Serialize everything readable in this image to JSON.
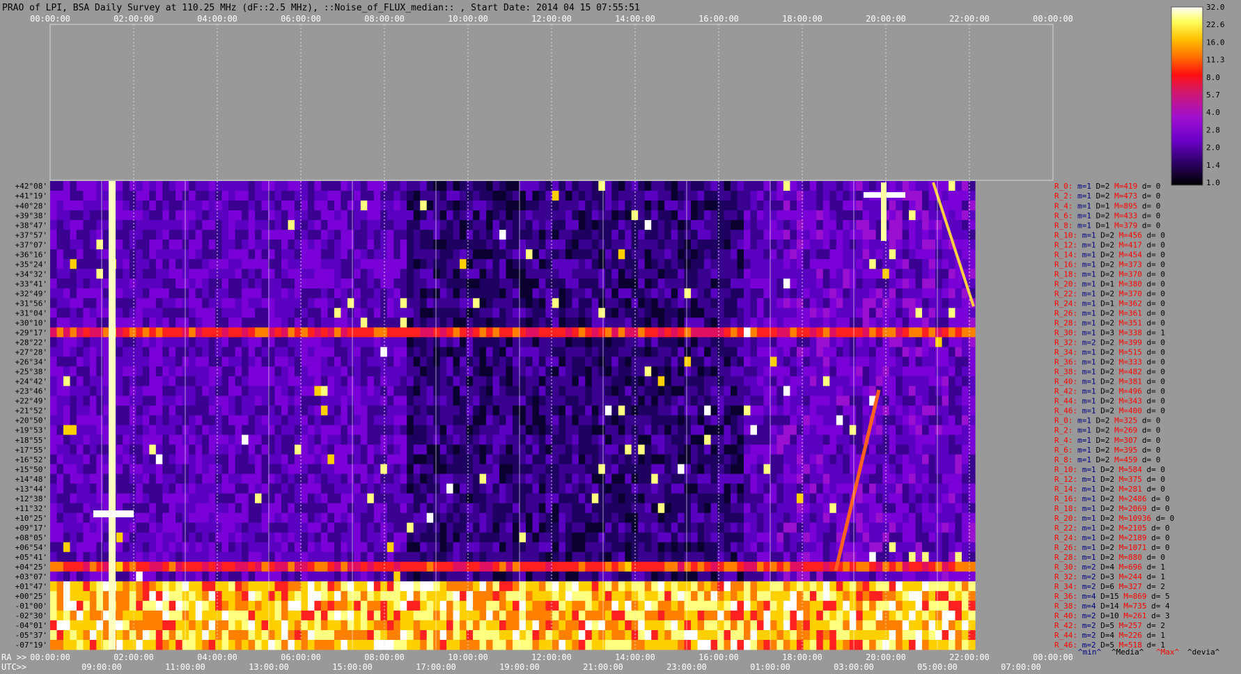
{
  "chart_data": {
    "type": "heatmap",
    "title": "PRAO of LPI, BSA Daily Survey at 110.25 MHz (dF::2.5 MHz), ::Noise_of_FLUX_median:: , Start Date: 2014 04 15 07:55:51",
    "top_axis": {
      "ticks": [
        "00:00:00",
        "02:00:00",
        "04:00:00",
        "06:00:00",
        "08:00:00",
        "10:00:00",
        "12:00:00",
        "14:00:00",
        "16:00:00",
        "18:00:00",
        "20:00:00",
        "22:00:00",
        "00:00:00"
      ]
    },
    "ra_axis": {
      "label": "RA >>",
      "ticks": [
        "00:00:00",
        "02:00:00",
        "04:00:00",
        "06:00:00",
        "08:00:00",
        "10:00:00",
        "12:00:00",
        "14:00:00",
        "16:00:00",
        "18:00:00",
        "20:00:00",
        "22:00:00",
        "00:00:00"
      ]
    },
    "utc_axis": {
      "label": "UTC>>",
      "ticks": [
        "09:00:00",
        "11:00:00",
        "13:00:00",
        "15:00:00",
        "17:00:00",
        "19:00:00",
        "21:00:00",
        "23:00:00",
        "01:00:00",
        "03:00:00",
        "05:00:00",
        "07:00:00"
      ]
    },
    "declinations": [
      "+42°08'",
      "+41°19'",
      "+40°28'",
      "+39°38'",
      "+38°47'",
      "+37°57'",
      "+37°07'",
      "+36°16'",
      "+35°24'",
      "+34°32'",
      "+33°41'",
      "+32°49'",
      "+31°56'",
      "+31°04'",
      "+30°10'",
      "+29°17'",
      "+28°22'",
      "+27°28'",
      "+26°34'",
      "+25°38'",
      "+24°42'",
      "+23°46'",
      "+22°49'",
      "+21°52'",
      "+20°50'",
      "+19°53'",
      "+18°55'",
      "+17°55'",
      "+16°52'",
      "+15°50'",
      "+14°48'",
      "+13°44'",
      "+12°38'",
      "+11°32'",
      "+10°25'",
      "+09°17'",
      "+08°05'",
      "+06°54'",
      "+05°41'",
      "+04°25'",
      "+03°07'",
      "+01°47'",
      "+00°25'",
      "-01°00'",
      "-02°30'",
      "-04°01'",
      "-05°37'",
      "-07°19'"
    ],
    "colorbar": {
      "ticks": [
        "32.0",
        "22.6",
        "16.0",
        "11.3",
        "8.0",
        "5.7",
        "4.0",
        "2.8",
        "2.0",
        "1.4",
        "1.0"
      ],
      "scale": "log",
      "range": [
        1.0,
        32.0
      ]
    },
    "beam_stats": [
      {
        "r": "R_0:",
        "m": "m=1",
        "d": "D=2",
        "mx": "M=419",
        "dev": "d= 0"
      },
      {
        "r": "R_2:",
        "m": "m=1",
        "d": "D=2",
        "mx": "M=473",
        "dev": "d= 0"
      },
      {
        "r": "R_4:",
        "m": "m=1",
        "d": "D=1",
        "mx": "M=895",
        "dev": "d= 0"
      },
      {
        "r": "R_6:",
        "m": "m=1",
        "d": "D=2",
        "mx": "M=433",
        "dev": "d= 0"
      },
      {
        "r": "R_8:",
        "m": "m=1",
        "d": "D=1",
        "mx": "M=379",
        "dev": "d= 0"
      },
      {
        "r": "R_10:",
        "m": "m=1",
        "d": "D=2",
        "mx": "M=456",
        "dev": "d= 0"
      },
      {
        "r": "R_12:",
        "m": "m=1",
        "d": "D=2",
        "mx": "M=417",
        "dev": "d= 0"
      },
      {
        "r": "R_14:",
        "m": "m=1",
        "d": "D=2",
        "mx": "M=454",
        "dev": "d= 0"
      },
      {
        "r": "R_16:",
        "m": "m=1",
        "d": "D=2",
        "mx": "M=373",
        "dev": "d= 0"
      },
      {
        "r": "R_18:",
        "m": "m=1",
        "d": "D=2",
        "mx": "M=370",
        "dev": "d= 0"
      },
      {
        "r": "R_20:",
        "m": "m=1",
        "d": "D=1",
        "mx": "M=380",
        "dev": "d= 0"
      },
      {
        "r": "R_22:",
        "m": "m=1",
        "d": "D=2",
        "mx": "M=370",
        "dev": "d= 0"
      },
      {
        "r": "R_24:",
        "m": "m=1",
        "d": "D=1",
        "mx": "M=362",
        "dev": "d= 0"
      },
      {
        "r": "R_26:",
        "m": "m=1",
        "d": "D=2",
        "mx": "M=361",
        "dev": "d= 0"
      },
      {
        "r": "R_28:",
        "m": "m=1",
        "d": "D=2",
        "mx": "M=351",
        "dev": "d= 0"
      },
      {
        "r": "R_30:",
        "m": "m=1",
        "d": "D=3",
        "mx": "M=338",
        "dev": "d= 1"
      },
      {
        "r": "R_32:",
        "m": "m=2",
        "d": "D=2",
        "mx": "M=399",
        "dev": "d= 0"
      },
      {
        "r": "R_34:",
        "m": "m=1",
        "d": "D=2",
        "mx": "M=515",
        "dev": "d= 0"
      },
      {
        "r": "R_36:",
        "m": "m=1",
        "d": "D=2",
        "mx": "M=333",
        "dev": "d= 0"
      },
      {
        "r": "R_38:",
        "m": "m=1",
        "d": "D=2",
        "mx": "M=482",
        "dev": "d= 0"
      },
      {
        "r": "R_40:",
        "m": "m=1",
        "d": "D=2",
        "mx": "M=381",
        "dev": "d= 0"
      },
      {
        "r": "R_42:",
        "m": "m=1",
        "d": "D=2",
        "mx": "M=496",
        "dev": "d= 0"
      },
      {
        "r": "R_44:",
        "m": "m=1",
        "d": "D=2",
        "mx": "M=343",
        "dev": "d= 0"
      },
      {
        "r": "R_46:",
        "m": "m=1",
        "d": "D=2",
        "mx": "M=400",
        "dev": "d= 0"
      },
      {
        "r": "R_0:",
        "m": "m=1",
        "d": "D=2",
        "mx": "M=325",
        "dev": "d= 0"
      },
      {
        "r": "R_2:",
        "m": "m=1",
        "d": "D=2",
        "mx": "M=269",
        "dev": "d= 0"
      },
      {
        "r": "R_4:",
        "m": "m=1",
        "d": "D=2",
        "mx": "M=307",
        "dev": "d= 0"
      },
      {
        "r": "R_6:",
        "m": "m=1",
        "d": "D=2",
        "mx": "M=395",
        "dev": "d= 0"
      },
      {
        "r": "R_8:",
        "m": "m=1",
        "d": "D=2",
        "mx": "M=459",
        "dev": "d= 0"
      },
      {
        "r": "R_10:",
        "m": "m=1",
        "d": "D=2",
        "mx": "M=584",
        "dev": "d= 0"
      },
      {
        "r": "R_12:",
        "m": "m=1",
        "d": "D=2",
        "mx": "M=375",
        "dev": "d= 0"
      },
      {
        "r": "R_14:",
        "m": "m=1",
        "d": "D=2",
        "mx": "M=281",
        "dev": "d= 0"
      },
      {
        "r": "R_16:",
        "m": "m=1",
        "d": "D=2",
        "mx": "M=2486",
        "dev": "d= 0"
      },
      {
        "r": "R_18:",
        "m": "m=1",
        "d": "D=2",
        "mx": "M=2069",
        "dev": "d= 0"
      },
      {
        "r": "R_20:",
        "m": "m=1",
        "d": "D=2",
        "mx": "M=10936",
        "dev": "d= 0"
      },
      {
        "r": "R_22:",
        "m": "m=1",
        "d": "D=2",
        "mx": "M=2105",
        "dev": "d= 0"
      },
      {
        "r": "R_24:",
        "m": "m=1",
        "d": "D=2",
        "mx": "M=2189",
        "dev": "d= 0"
      },
      {
        "r": "R_26:",
        "m": "m=1",
        "d": "D=2",
        "mx": "M=1071",
        "dev": "d= 0"
      },
      {
        "r": "R_28:",
        "m": "m=1",
        "d": "D=2",
        "mx": "M=880",
        "dev": "d= 0"
      },
      {
        "r": "R_30:",
        "m": "m=2",
        "d": "D=4",
        "mx": "M=696",
        "dev": "d= 1"
      },
      {
        "r": "R_32:",
        "m": "m=2",
        "d": "D=3",
        "mx": "M=244",
        "dev": "d= 1"
      },
      {
        "r": "R_34:",
        "m": "m=2",
        "d": "D=6",
        "mx": "M=327",
        "dev": "d= 2"
      },
      {
        "r": "R_36:",
        "m": "m=4",
        "d": "D=15",
        "mx": "M=869",
        "dev": "d= 5"
      },
      {
        "r": "R_38:",
        "m": "m=4",
        "d": "D=14",
        "mx": "M=735",
        "dev": "d= 4"
      },
      {
        "r": "R_40:",
        "m": "m=2",
        "d": "D=10",
        "mx": "M=261",
        "dev": "d= 3"
      },
      {
        "r": "R_42:",
        "m": "m=2",
        "d": "D=5",
        "mx": "M=257",
        "dev": "d= 2"
      },
      {
        "r": "R_44:",
        "m": "m=2",
        "d": "D=4",
        "mx": "M=226",
        "dev": "d= 1"
      },
      {
        "r": "R_46:",
        "m": "m=2",
        "d": "D=5",
        "mx": "M=518",
        "dev": "d= 1"
      }
    ],
    "stat_legend": [
      "^min^",
      "^Media^",
      "^Max^",
      "^devia^"
    ],
    "colors": {
      "background": "#999999",
      "title_text": "#000000",
      "axis_text": "#ffffff",
      "beam_label": "#ff0000",
      "min_text": "#000080",
      "max_text": "#ff0000",
      "dec_text": "#000000"
    }
  }
}
